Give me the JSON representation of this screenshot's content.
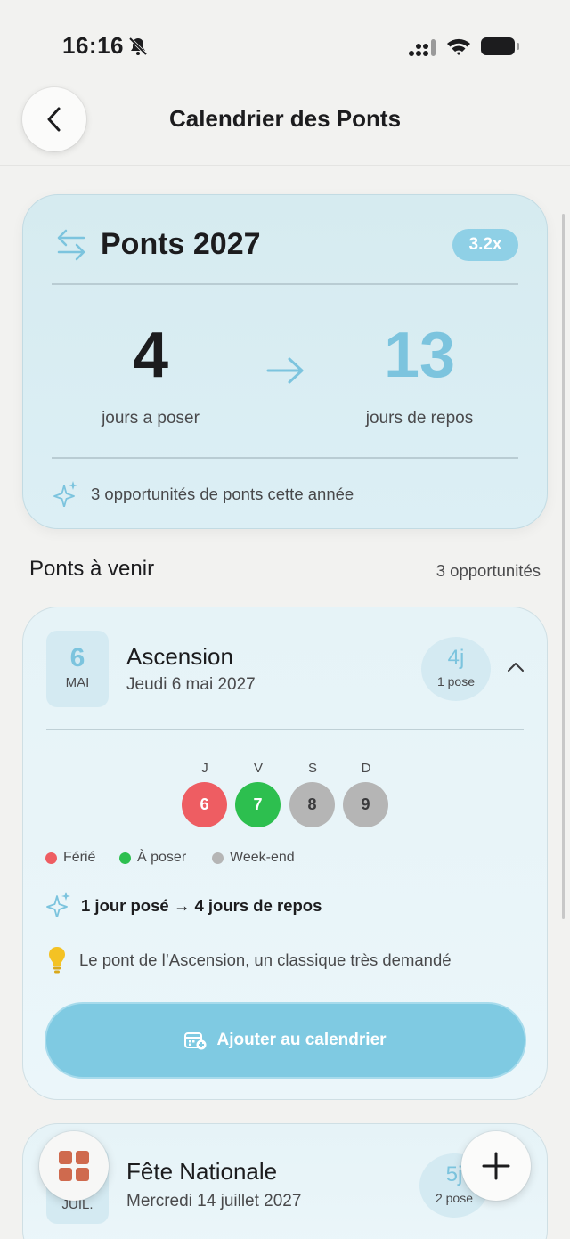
{
  "status_bar": {
    "time": "16:16"
  },
  "nav": {
    "title": "Calendrier des Ponts"
  },
  "summary": {
    "title": "Ponts 2027",
    "ratio_badge": "3.2x",
    "days_to_take": "4",
    "days_to_take_label": "jours a poser",
    "rest_days": "13",
    "rest_days_label": "jours de repos",
    "footer": "3 opportunités de ponts cette année"
  },
  "section": {
    "title": "Ponts à venir",
    "count": "3 opportunités"
  },
  "bridges": [
    {
      "day": "6",
      "month": "MAI",
      "name": "Ascension",
      "date": "Jeudi 6 mai 2027",
      "total_days": "4j",
      "days_taken": "1 pose",
      "weekdays": [
        "J",
        "V",
        "S",
        "D"
      ],
      "dates": [
        "6",
        "7",
        "8",
        "9"
      ],
      "day_types": [
        "ferie",
        "a_poser",
        "weekend",
        "weekend"
      ],
      "gain": "1 jour posé → 4 jours de repos",
      "tip": "Le pont de l’Ascension, un classique très demandé",
      "add_button": "Ajouter au calendrier"
    },
    {
      "month": "JUIL.",
      "name": "Fête Nationale",
      "date": "Mercredi 14 juillet 2027",
      "total_days": "5j",
      "days_taken": "2 pose"
    }
  ],
  "legend": {
    "ferie": "Férié",
    "a_poser": "À poser",
    "weekend": "Week-end"
  },
  "colors": {
    "accent": "#7cc4de",
    "ferie": "#ee5d62",
    "a_poser": "#2dbf4f",
    "weekend": "#b5b5b5",
    "button": "#7fcae2"
  },
  "icons": {
    "back": "chevron-left-icon",
    "bell_off": "bell-slash-icon",
    "swap": "arrows-swap-icon",
    "sparkles": "sparkles-icon",
    "bulb": "lightbulb-icon",
    "calendar_add": "calendar-add-icon",
    "grid": "grid-icon",
    "plus": "plus-icon"
  }
}
